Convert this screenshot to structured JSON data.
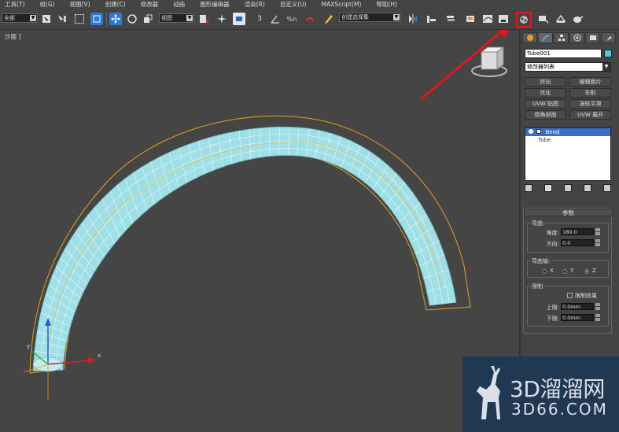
{
  "menu": [
    "工具(T)",
    "组(G)",
    "视图(V)",
    "创建(C)",
    "修改器",
    "动画",
    "图形编辑器",
    "渲染(R)",
    "自定义(U)",
    "MAXScript(M)",
    "帮助(H)"
  ],
  "toolbar": {
    "selection_filter": "全部",
    "ref_coord": "视图",
    "named_selection": "创建选择集",
    "snap_number": "3",
    "percent_snap": "%n"
  },
  "viewport": {
    "label": "+ ] 透视 ]",
    "label_display": "沙面 ]"
  },
  "command_panel": {
    "object_name": "Tube001",
    "modifier_list": "修改器列表",
    "modifier_buttons": [
      "挤出",
      "编辑面片",
      "优化",
      "车削",
      "UVW 贴图",
      "涡轮平滑",
      "倒角剖面",
      "UVW 展开"
    ],
    "stack": [
      "Bend",
      "Tube"
    ],
    "params_title": "参数",
    "bend_group": "弯曲:",
    "angle_label": "角度:",
    "angle_value": "180.0",
    "direction_label": "方向:",
    "direction_value": "0.0",
    "axis_group": "弯曲轴:",
    "axis_x": "X",
    "axis_y": "Y",
    "axis_z": "Z",
    "limit_group": "限制",
    "limit_effect": "限制效果",
    "upper_label": "上限:",
    "upper_value": "0.0mm",
    "lower_label": "下限:",
    "lower_value": "0.0mm"
  },
  "watermark": {
    "line1": "3D溜溜网",
    "line2": "3D66.COM"
  },
  "colors": {
    "tube": "#9fdfe6",
    "accent_red": "#e8141b",
    "selection_blue": "#3a6ec8"
  }
}
